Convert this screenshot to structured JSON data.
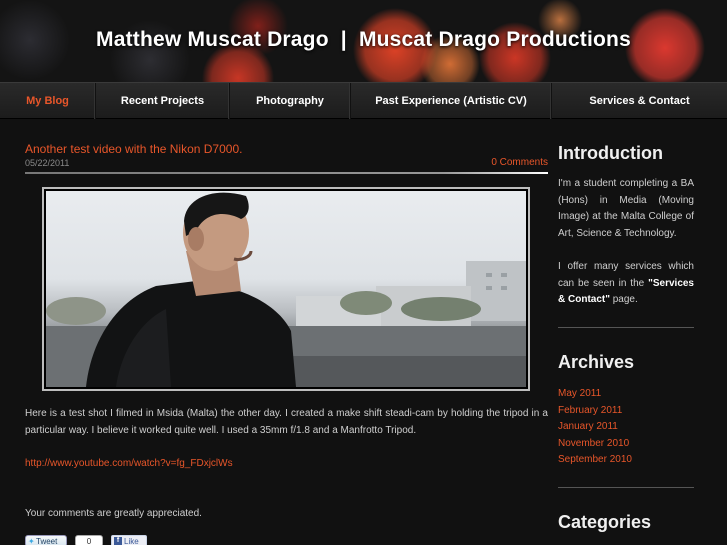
{
  "header": {
    "title": "Matthew Muscat Drago  |  Muscat Drago Productions"
  },
  "nav": {
    "items": [
      {
        "label": "My Blog",
        "active": true
      },
      {
        "label": "Recent Projects"
      },
      {
        "label": "Photography"
      },
      {
        "label": "Past Experience (Artistic CV)"
      },
      {
        "label": "Services & Contact"
      }
    ]
  },
  "post": {
    "title": "Another test video with the Nikon D7000.",
    "date": "05/22/2011",
    "comments": "0 Comments",
    "body": "Here is a test shot I filmed in Msida (Malta) the other day. I created a make shift steadi-cam by holding the tripod in a particular way. I believe it worked quite well. I used a 35mm f/1.8 and a Manfrotto Tripod.",
    "link": "http://www.youtube.com/watch?v=fg_FDxjclWs",
    "footer": "Your comments are greatly appreciated.",
    "share": {
      "tweet": "Tweet",
      "tweet_count": "0",
      "like": "Like"
    }
  },
  "sidebar": {
    "intro_heading": "Introduction",
    "intro_p1": "I'm a student completing a BA (Hons) in Media (Moving Image) at the Malta College of Art, Science & Technology.",
    "intro_p2_a": "I offer many services which can be seen in the ",
    "intro_p2_b": "\"Services & Contact\"",
    "intro_p2_c": " page.",
    "archives_heading": "Archives",
    "archives": [
      "May 2011",
      "February 2011",
      "January 2011",
      "November 2010",
      "September 2010"
    ],
    "categories_heading": "Categories"
  },
  "colors": {
    "accent": "#e8562a",
    "background": "#111111"
  }
}
